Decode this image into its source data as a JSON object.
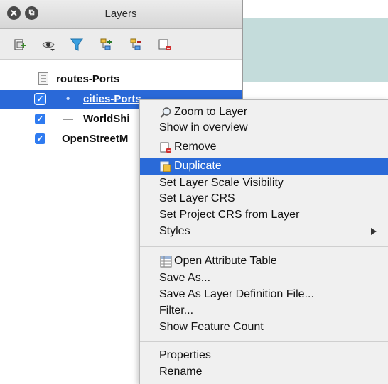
{
  "window": {
    "title": "Layers",
    "close_glyph": "✕",
    "restore_glyph": "⧉"
  },
  "toolbar": {
    "icons": [
      "add-group-icon",
      "visibility-eye-icon",
      "filter-icon",
      "expand-all-icon",
      "collapse-all-icon",
      "remove-layer-icon"
    ]
  },
  "layers": {
    "group": {
      "label": "routes-Ports"
    },
    "items": [
      {
        "label": "cities-Ports",
        "checked": true,
        "selected": true,
        "symbol": "•"
      },
      {
        "label": "WorldShi",
        "checked": true,
        "selected": false,
        "symbol": "—"
      },
      {
        "label": "OpenStreetM",
        "checked": true,
        "selected": false
      }
    ],
    "check_glyph": "✓"
  },
  "context_menu": {
    "items": [
      {
        "label": "Zoom to Layer",
        "icon": "zoom-icon"
      },
      {
        "label": "Show in overview"
      },
      {
        "label": "Remove",
        "icon": "remove-icon"
      },
      {
        "label": "Duplicate",
        "icon": "duplicate-icon",
        "highlighted": true
      },
      {
        "label": "Set Layer Scale Visibility"
      },
      {
        "label": "Set Layer CRS"
      },
      {
        "label": "Set Project CRS from Layer"
      },
      {
        "label": "Styles",
        "submenu": true
      },
      {
        "label": "Open Attribute Table",
        "icon": "table-icon"
      },
      {
        "label": "Save As..."
      },
      {
        "label": "Save As Layer Definition File..."
      },
      {
        "label": "Filter..."
      },
      {
        "label": "Show Feature Count"
      },
      {
        "label": "Properties"
      },
      {
        "label": "Rename"
      }
    ]
  },
  "colors": {
    "selection": "#2a69d8",
    "checkbox": "#2f7bf0",
    "map_water": "#c4dcdb"
  }
}
